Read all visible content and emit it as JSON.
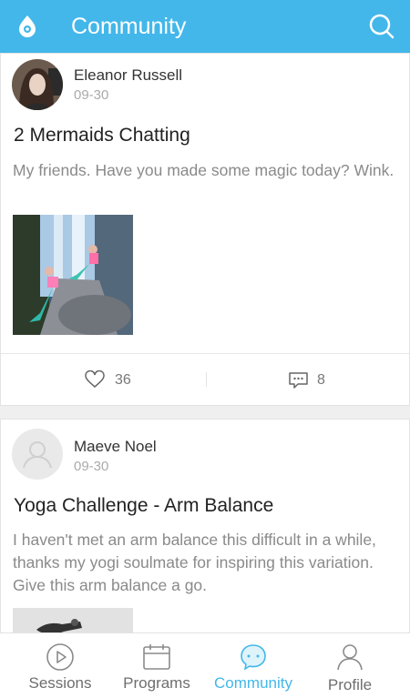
{
  "header": {
    "title": "Community",
    "accent_color": "#43b7ea"
  },
  "posts": [
    {
      "author": "Eleanor Russell",
      "date": "09-30",
      "title": "2 Mermaids Chatting",
      "body": "My friends. Have you made some magic today? Wink.",
      "likes": "36",
      "comments": "8"
    },
    {
      "author": "Maeve Noel",
      "date": "09-30",
      "title": "Yoga Challenge - Arm Balance",
      "body": "I haven't met an arm balance this difficult in a while, thanks my yogi soulmate for inspiring this variation. Give this arm balance a go."
    }
  ],
  "tabs": [
    {
      "label": "Sessions",
      "icon": "play-circle-icon"
    },
    {
      "label": "Programs",
      "icon": "calendar-icon"
    },
    {
      "label": "Community",
      "icon": "chat-bubble-icon",
      "active": true
    },
    {
      "label": "Profile",
      "icon": "person-icon"
    }
  ]
}
